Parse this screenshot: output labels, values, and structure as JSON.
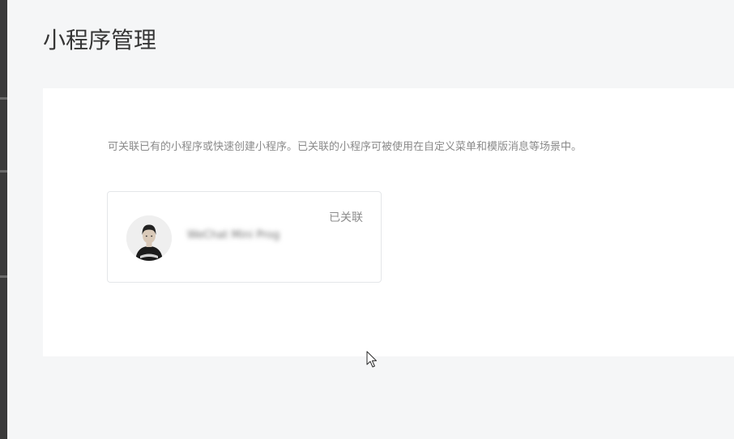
{
  "page": {
    "title": "小程序管理",
    "background_color": "#f5f6f7"
  },
  "panel": {
    "description": "可关联已有的小程序或快速创建小程序。已关联的小程序可被使用在自定义菜单和模版消息等场景中。"
  },
  "linked_miniprogram": {
    "name": "WeChat Mini Prog",
    "status": "已关联",
    "avatar_icon": "person-avatar-icon"
  },
  "cursor_icon": "mouse-pointer-icon"
}
